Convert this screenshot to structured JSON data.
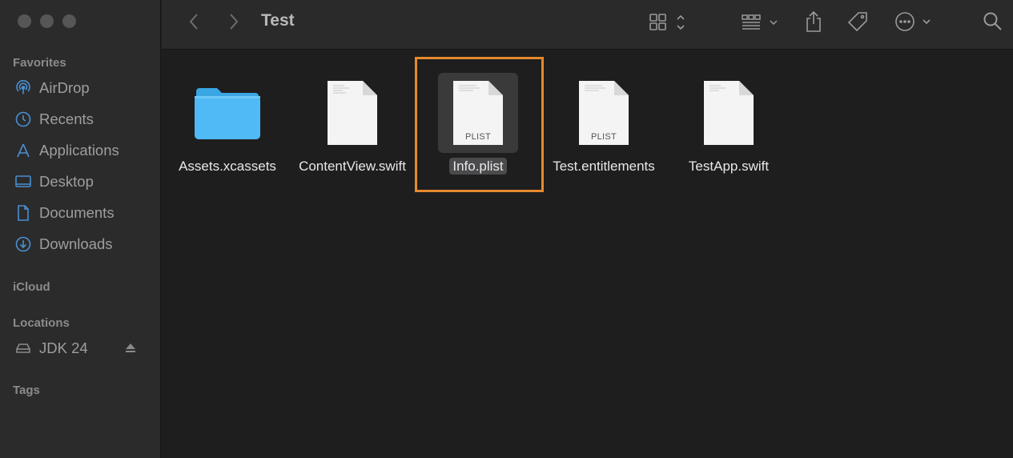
{
  "window": {
    "title": "Test"
  },
  "sidebar": {
    "favorites_title": "Favorites",
    "favorites": [
      {
        "label": "AirDrop",
        "icon": "airdrop-icon"
      },
      {
        "label": "Recents",
        "icon": "clock-icon"
      },
      {
        "label": "Applications",
        "icon": "applications-icon"
      },
      {
        "label": "Desktop",
        "icon": "desktop-icon"
      },
      {
        "label": "Documents",
        "icon": "document-icon"
      },
      {
        "label": "Downloads",
        "icon": "download-icon"
      }
    ],
    "icloud_title": "iCloud",
    "locations_title": "Locations",
    "locations": [
      {
        "label": "JDK 24",
        "icon": "drive-icon",
        "eject_icon": "eject-icon"
      }
    ],
    "tags_title": "Tags"
  },
  "toolbar": {
    "icons": [
      "back-icon",
      "forward-icon",
      "icon-view-icon",
      "group-icon",
      "share-icon",
      "tag-icon",
      "more-icon",
      "search-icon"
    ]
  },
  "files": [
    {
      "name": "Assets.xcassets",
      "kind": "folder",
      "badge": ""
    },
    {
      "name": "ContentView.swift",
      "kind": "document",
      "badge": ""
    },
    {
      "name": "Info.plist",
      "kind": "document",
      "badge": "PLIST",
      "selected": true
    },
    {
      "name": "Test.entitlements",
      "kind": "document",
      "badge": "PLIST"
    },
    {
      "name": "TestApp.swift",
      "kind": "document",
      "badge": ""
    }
  ],
  "colors": {
    "sidebar_bg": "#2b2b2c",
    "content_bg": "#1e1e1e",
    "folder_blue": "#45b5f2",
    "highlight": "#e58a2e",
    "sidebar_icon": "#4a8fd0"
  }
}
